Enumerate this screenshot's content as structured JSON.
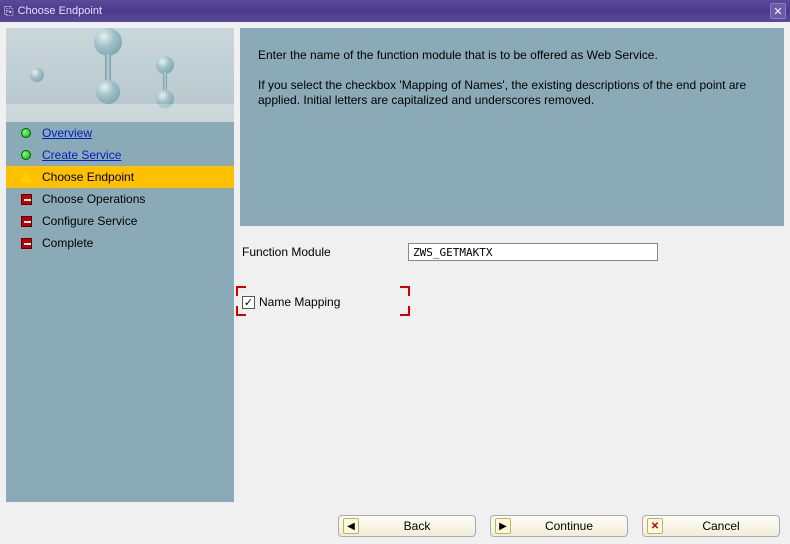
{
  "titlebar": {
    "title": "Choose Endpoint"
  },
  "sidebar": {
    "items": [
      {
        "label": "Overview",
        "status": "done"
      },
      {
        "label": "Create Service",
        "status": "done"
      },
      {
        "label": "Choose Endpoint",
        "status": "current"
      },
      {
        "label": "Choose Operations",
        "status": "pending"
      },
      {
        "label": "Configure Service",
        "status": "pending"
      },
      {
        "label": "Complete",
        "status": "pending"
      }
    ]
  },
  "info": {
    "line1": "Enter the name of the function module that is to be offered as Web Service.",
    "line2": "If you select the checkbox 'Mapping of Names', the existing descriptions of the end point are applied. Initial letters are capitalized and underscores removed."
  },
  "form": {
    "function_module_label": "Function Module",
    "function_module_value": "ZWS_GETMAKTX",
    "name_mapping_label": "Name Mapping",
    "name_mapping_checked": true
  },
  "buttons": {
    "back": "Back",
    "continue": "Continue",
    "cancel": "Cancel"
  }
}
